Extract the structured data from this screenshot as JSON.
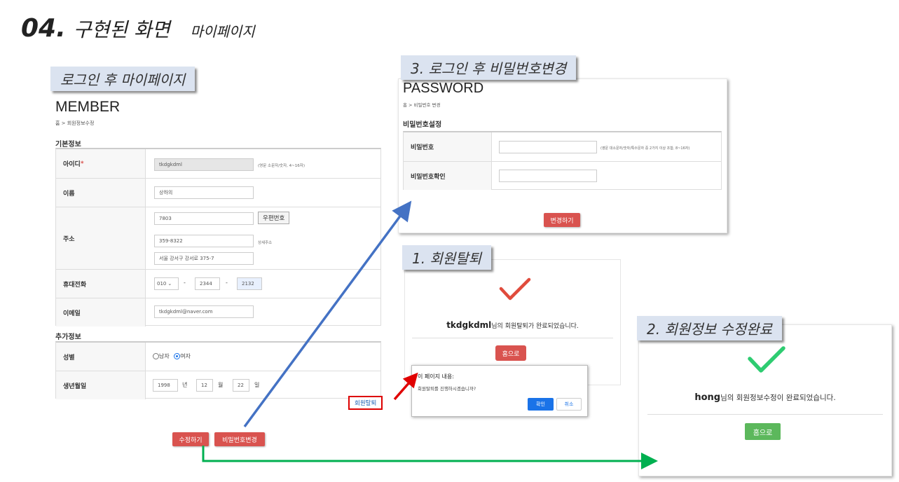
{
  "slide": {
    "number": "04.",
    "title": "구현된 화면",
    "subtitle": "마이페이지"
  },
  "captions": {
    "mypage": "로그인 후 마이페이지",
    "password": "3. 로그인 후 비밀번호변경",
    "withdraw": "1. 회원탈퇴",
    "edit_done": "2. 회원정보 수정완료"
  },
  "member": {
    "heading": "MEMBER",
    "breadcrumb": "홈 > 회원정보수정",
    "basic_section": "기본정보",
    "id": {
      "label": "아이디",
      "required_mark": "*",
      "value": "tkdgkdml",
      "hint": "(영문 소문자/숫자, 4~16자)"
    },
    "name": {
      "label": "이름",
      "value": "상하의"
    },
    "address": {
      "label": "주소",
      "postcode": "7803",
      "postcode_button": "우편번호",
      "address1": "359-8322",
      "address1_hint": "상세주소",
      "address2": "서울 강서구 강서로 375-7"
    },
    "phone": {
      "label": "휴대전화",
      "prefix": "010",
      "middle": "2344",
      "last": "2132",
      "dash": "-"
    },
    "email": {
      "label": "이메일",
      "value": "tkdgkdml@naver.com"
    },
    "extra_section": "추가정보",
    "gender": {
      "label": "성별",
      "male": "남자",
      "female": "여자",
      "selected": "여자"
    },
    "birth": {
      "label": "생년월일",
      "year": "1998",
      "year_unit": "년",
      "month": "12",
      "month_unit": "월",
      "day": "22",
      "day_unit": "일"
    },
    "withdraw_link": "회원탈퇴",
    "save_button": "수정하기",
    "change_pw_button": "비밀번호변경"
  },
  "password": {
    "heading": "PASSWORD",
    "breadcrumb": "홈 > 비밀번호 변경",
    "section": "비밀번호설정",
    "pw_label": "비밀번호",
    "pw_hint": "(영문 대소문자/숫자/특수문자 중 2가지 이상 조합, 8~16자)",
    "pw_confirm_label": "비밀번호확인",
    "submit": "변경하기"
  },
  "withdraw": {
    "user": "tkdgkdml",
    "message": "님의 회원탈퇴가 완료되었습니다.",
    "home_button": "홈으로",
    "dialog": {
      "title": "이 페이지 내용:",
      "message": "회원탈퇴를 진행하시겠습니까?",
      "ok": "확인",
      "cancel": "취소"
    }
  },
  "edit_done": {
    "user": "hong",
    "message": "님의 회원정보수정이 완료되었습니다.",
    "home_button": "홈으로"
  },
  "colors": {
    "caption_bg": "#dbe3f0",
    "red_button": "#d9534f",
    "green_button": "#5cb85c",
    "check_red": "#e04b3c",
    "check_green": "#2ecc71",
    "arrow_blue": "#4472c4",
    "arrow_green": "#00b050",
    "arrow_red": "#e00000"
  }
}
